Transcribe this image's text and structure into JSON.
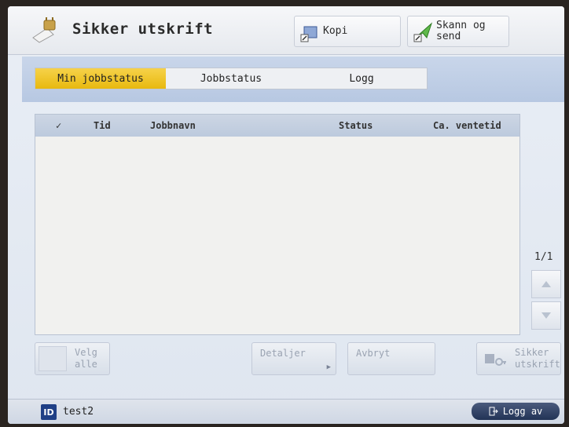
{
  "header": {
    "title": "Sikker utskrift",
    "buttons": {
      "kopi": "Kopi",
      "skann_line1": "Skann og",
      "skann_line2": "send"
    }
  },
  "tabs": [
    {
      "label": "Min jobbstatus",
      "active": true
    },
    {
      "label": "Jobbstatus",
      "active": false
    },
    {
      "label": "Logg",
      "active": false
    }
  ],
  "table": {
    "columns": {
      "check": "✓",
      "tid": "Tid",
      "jobbnavn": "Jobbnavn",
      "status": "Status",
      "ventetid": "Ca. ventetid"
    },
    "rows": []
  },
  "pagination": {
    "indicator": "1/1"
  },
  "actions": {
    "velg_line1": "Velg",
    "velg_line2": "alle",
    "detaljer": "Detaljer",
    "avbryt": "Avbryt",
    "sikker_line1": "Sikker",
    "sikker_line2": "utskrift"
  },
  "footer": {
    "id_badge": "ID",
    "user": "test2",
    "logout": "Logg av"
  },
  "colors": {
    "active_tab": "#e8b90f",
    "header_bg": "#e6e9ee",
    "logout_bg": "#223356"
  }
}
